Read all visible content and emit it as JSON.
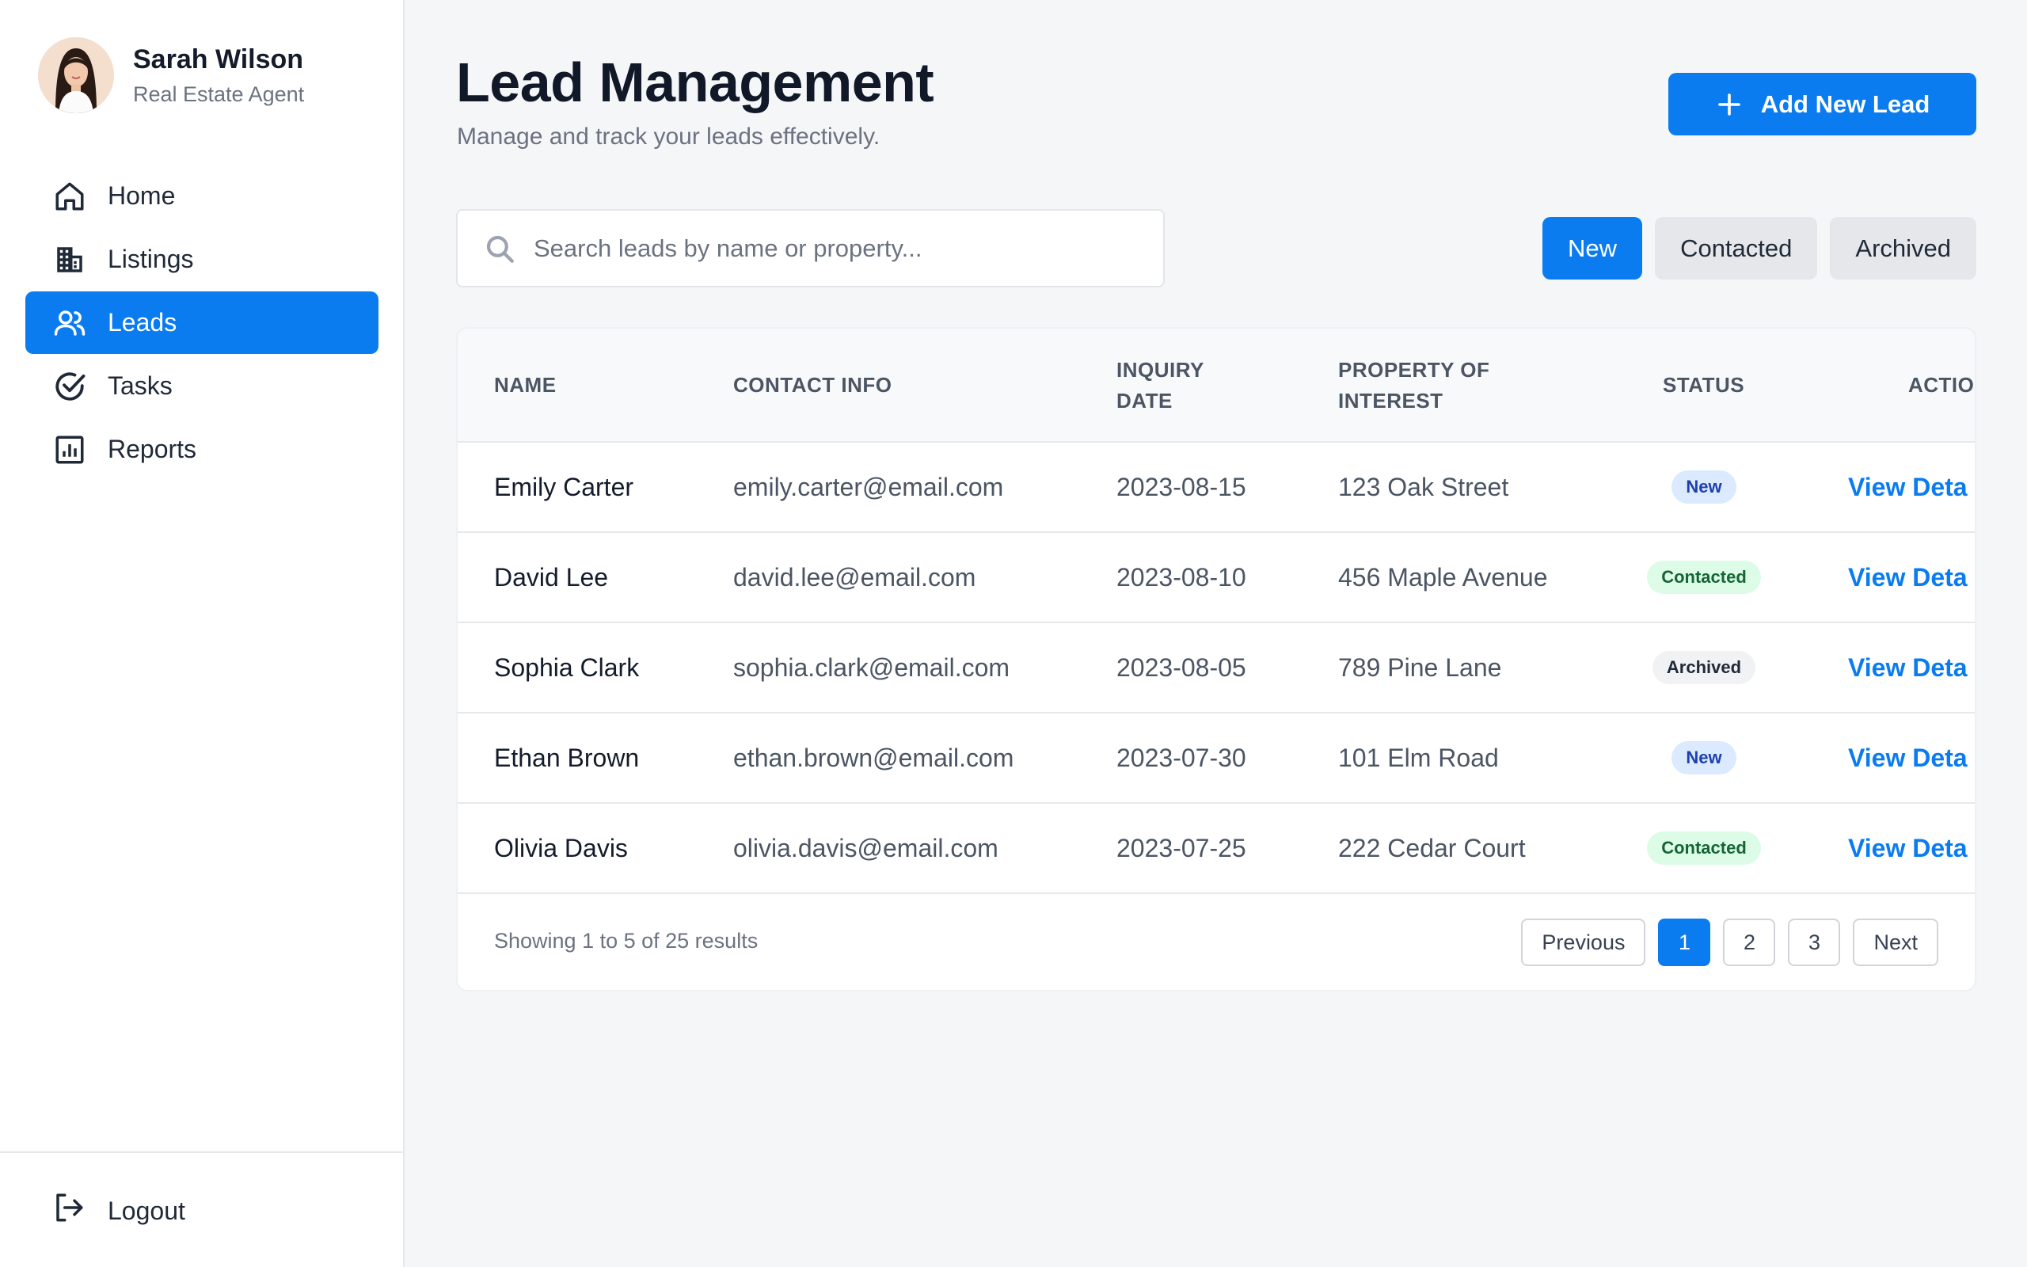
{
  "profile": {
    "name": "Sarah Wilson",
    "role": "Real Estate Agent"
  },
  "nav": [
    {
      "label": "Home",
      "icon": "home-icon",
      "active": false
    },
    {
      "label": "Listings",
      "icon": "building-icon",
      "active": false
    },
    {
      "label": "Leads",
      "icon": "users-icon",
      "active": true
    },
    {
      "label": "Tasks",
      "icon": "check-circle-icon",
      "active": false
    },
    {
      "label": "Reports",
      "icon": "bar-chart-icon",
      "active": false
    }
  ],
  "logout": {
    "label": "Logout",
    "icon": "logout-icon"
  },
  "header": {
    "title": "Lead Management",
    "subtitle": "Manage and track your leads effectively.",
    "add_button": "Add New Lead"
  },
  "search": {
    "placeholder": "Search leads by name or property...",
    "value": ""
  },
  "filters": [
    {
      "label": "New",
      "active": true
    },
    {
      "label": "Contacted",
      "active": false
    },
    {
      "label": "Archived",
      "active": false
    }
  ],
  "table": {
    "columns": {
      "name": "NAME",
      "contact": "CONTACT INFO",
      "date_line1": "INQUIRY",
      "date_line2": "DATE",
      "property_line1": "PROPERTY OF",
      "property_line2": "INTEREST",
      "status": "STATUS",
      "actions": "ACTIO"
    },
    "rows": [
      {
        "name": "Emily Carter",
        "email": "emily.carter@email.com",
        "date": "2023-08-15",
        "property": "123 Oak Street",
        "status": "New",
        "status_type": "new",
        "action": "View Deta"
      },
      {
        "name": "David Lee",
        "email": "david.lee@email.com",
        "date": "2023-08-10",
        "property": "456 Maple Avenue",
        "status": "Contacted",
        "status_type": "contacted",
        "action": "View Deta"
      },
      {
        "name": "Sophia Clark",
        "email": "sophia.clark@email.com",
        "date": "2023-08-05",
        "property": "789 Pine Lane",
        "status": "Archived",
        "status_type": "archived",
        "action": "View Deta"
      },
      {
        "name": "Ethan Brown",
        "email": "ethan.brown@email.com",
        "date": "2023-07-30",
        "property": "101 Elm Road",
        "status": "New",
        "status_type": "new",
        "action": "View Deta"
      },
      {
        "name": "Olivia Davis",
        "email": "olivia.davis@email.com",
        "date": "2023-07-25",
        "property": "222 Cedar Court",
        "status": "Contacted",
        "status_type": "contacted",
        "action": "View Deta"
      }
    ]
  },
  "pagination": {
    "summary": "Showing 1 to 5 of 25 results",
    "previous": "Previous",
    "next": "Next",
    "pages": [
      "1",
      "2",
      "3"
    ],
    "current": "1"
  },
  "colors": {
    "accent": "#0a7cf0",
    "background": "#f5f6f8",
    "badge_new_bg": "#dbeafe",
    "badge_contacted_bg": "#dcfce7",
    "badge_archived_bg": "#f1f2f4"
  }
}
